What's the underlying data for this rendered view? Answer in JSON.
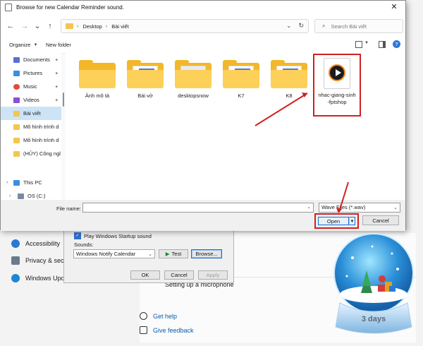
{
  "dialog": {
    "title": "Browse for new Calendar Reminder sound.",
    "close_glyph": "✕",
    "nav": {
      "back": "←",
      "forward": "→",
      "down": "⌄",
      "up": "↑"
    },
    "address": {
      "segments": [
        "Desktop",
        "Bài viết"
      ],
      "separator": "›"
    },
    "search_placeholder": "Search Bài viết",
    "toolbar": {
      "organize": "Organize",
      "new_folder": "New folder",
      "help": "?"
    },
    "sidebar": [
      {
        "label": "Documents",
        "icon": "documents-icon",
        "color": "#5a6fd6",
        "pinned": true
      },
      {
        "label": "Pictures",
        "icon": "pictures-icon",
        "color": "#3a8ee6",
        "pinned": true
      },
      {
        "label": "Music",
        "icon": "music-icon",
        "color": "#e2493a",
        "pinned": true
      },
      {
        "label": "Videos",
        "icon": "videos-icon",
        "color": "#8a4fd6",
        "pinned": true
      },
      {
        "label": "Bài viết",
        "icon": "folder-icon",
        "color": "#f3c64f",
        "pinned": false,
        "selected": true
      },
      {
        "label": "Mô hình trình d",
        "icon": "folder-icon",
        "color": "#f3c64f",
        "pinned": false
      },
      {
        "label": "Mô hình trình d",
        "icon": "folder-icon",
        "color": "#f3c64f",
        "pinned": false
      },
      {
        "label": "(HỦY) Công ngl",
        "icon": "folder-icon",
        "color": "#f3c64f",
        "pinned": false
      },
      {
        "label": "This PC",
        "icon": "this-pc-icon",
        "color": "#3a8ee6",
        "pinned": false,
        "expand": "›"
      },
      {
        "label": "OS (C:)",
        "icon": "drive-icon",
        "color": "#7a8aa0",
        "pinned": false,
        "expand": "›"
      }
    ],
    "files": [
      {
        "name": "Ảnh mô tả",
        "type": "folder"
      },
      {
        "name": "Bài vở",
        "type": "folder-docs"
      },
      {
        "name": "desktopsnow",
        "type": "folder-image"
      },
      {
        "name": "K7",
        "type": "folder-docs"
      },
      {
        "name": "K8",
        "type": "folder-docs"
      }
    ],
    "audio_file": {
      "name_line1": "nhac-giang-sinh",
      "name_line2": "-fptshop"
    },
    "footer": {
      "file_name_label": "File name:",
      "file_name_value": "",
      "file_type": "Wave Files (*.wav)",
      "open": "Open",
      "cancel": "Cancel"
    }
  },
  "sound_dialog": {
    "startup_sound": "Play Windows Startup sound",
    "sounds_label": "Sounds:",
    "sound_value": "Windows Notify Calendar",
    "test": "Test",
    "browse": "Browse...",
    "ok": "OK",
    "cancel": "Cancel",
    "apply": "Apply"
  },
  "settings": {
    "nav_items": [
      {
        "label": "Accessibility",
        "icon": "accessibility-icon",
        "color": "#2b79d6"
      },
      {
        "label": "Privacy & secu",
        "icon": "shield-icon",
        "color": "#6b7a8c"
      },
      {
        "label": "Windows Upd",
        "icon": "update-icon",
        "color": "#1e86d6"
      }
    ],
    "mic_row": "Setting up a microphone",
    "get_help": "Get help",
    "give_feedback": "Give feedback"
  },
  "snow_globe": {
    "caption": "3 days"
  },
  "colors": {
    "highlight_red": "#d02020",
    "accent_blue": "#1e6fd0",
    "folder_yellow": "#f3b72a"
  }
}
